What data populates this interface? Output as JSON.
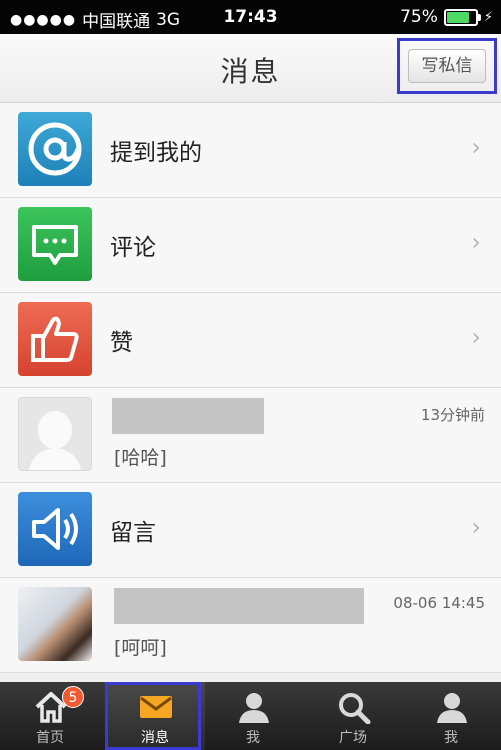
{
  "status_bar": {
    "carrier": "中国联通",
    "network": "3G",
    "time": "17:43",
    "battery": "75%",
    "battery_level": 0.75
  },
  "nav": {
    "title": "消息",
    "compose_label": "写私信"
  },
  "messages": [
    {
      "type": "category",
      "icon": "at-icon",
      "label": "提到我的"
    },
    {
      "type": "category",
      "icon": "comment-icon",
      "label": "评论"
    },
    {
      "type": "category",
      "icon": "thumbs-up-icon",
      "label": "赞"
    },
    {
      "type": "conversation",
      "icon": "default-avatar-icon",
      "text": "[哈哈]",
      "time": "13分钟前"
    },
    {
      "type": "category",
      "icon": "speaker-icon",
      "label": "留言"
    },
    {
      "type": "conversation",
      "icon": "photo-avatar",
      "text": "[呵呵]",
      "time": "08-06 14:45"
    }
  ],
  "tabbar": {
    "tabs": [
      {
        "label": "首页",
        "icon": "home-icon",
        "badge": "5"
      },
      {
        "label": "消息",
        "icon": "envelope-icon",
        "active": true
      },
      {
        "label": "我",
        "icon": "person-icon"
      },
      {
        "label": "广场",
        "icon": "search-icon"
      },
      {
        "label": "我",
        "icon": "person-icon"
      }
    ]
  },
  "colors": {
    "accent_blue": "#3b3bd0",
    "badge": "#f25a32",
    "tab_active_icon": "#f5a623"
  }
}
